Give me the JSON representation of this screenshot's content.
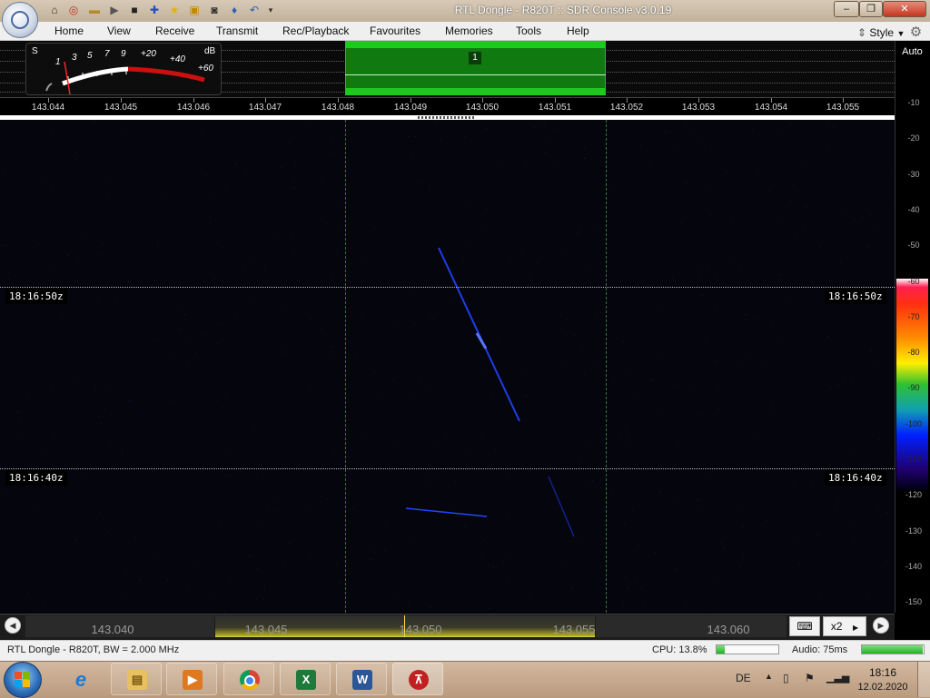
{
  "window": {
    "title": "RTL Dongle - R820T :: SDR Console v3.0.19",
    "controls": [
      "minimize",
      "maximize",
      "close"
    ],
    "quick_access_icons": [
      "home-icon",
      "lifebuoy-icon",
      "folder-icon",
      "play-icon",
      "stop-icon",
      "add-icon",
      "star-icon",
      "lock-icon",
      "camera-icon",
      "dropper-icon",
      "undo-icon",
      "dropdown-icon"
    ]
  },
  "menu": {
    "items": [
      "Home",
      "View",
      "Receive",
      "Transmit",
      "Rec/Playback",
      "Favourites",
      "Memories",
      "Tools",
      "Help"
    ],
    "style_label": "Style"
  },
  "smeter": {
    "s_label": "S",
    "db_label": "dB",
    "scale": [
      "1",
      "3",
      "5",
      "7",
      "9",
      "+20",
      "+40",
      "+60"
    ]
  },
  "vfo": {
    "number": "1"
  },
  "frequency_scale": {
    "ticks": [
      "143.044",
      "143.045",
      "143.046",
      "143.047",
      "143.048",
      "143.049",
      "143.050",
      "143.051",
      "143.052",
      "143.053",
      "143.054",
      "143.055"
    ]
  },
  "waterfall": {
    "time_markers": [
      "18:16:50z",
      "18:16:40z"
    ]
  },
  "db_scale": {
    "auto_label": "Auto",
    "ticks": [
      "-10",
      "-20",
      "-30",
      "-40",
      "-50",
      "-60",
      "-70",
      "-80",
      "-90",
      "-100",
      "-110",
      "-120",
      "-130",
      "-140",
      "-150"
    ]
  },
  "tuning_bar": {
    "labels": [
      "143.040",
      "143.045",
      "143.050",
      "143.055",
      "143.060"
    ],
    "zoom_label": "x2"
  },
  "status": {
    "device": "RTL Dongle - R820T, BW = 2.000 MHz",
    "cpu_label": "CPU: 13.8%",
    "cpu_fraction": 0.138,
    "audio_label": "Audio: 75ms",
    "audio_fraction": 0.98
  },
  "taskbar": {
    "apps": [
      "file-explorer",
      "internet-explorer",
      "media-player",
      "chrome",
      "excel",
      "word",
      "sdr-console"
    ],
    "language": "DE",
    "time": "18:16",
    "date": "12.02.2020"
  },
  "colors": {
    "filter_green": "#1fc81f",
    "signal_blue": "#1a3cff",
    "menu_bg": "#efefef"
  }
}
